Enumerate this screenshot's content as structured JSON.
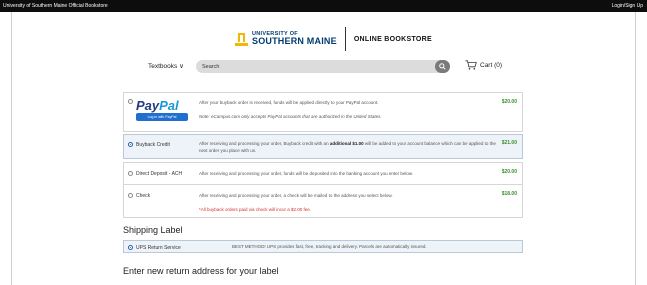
{
  "topbar": {
    "left": "University of Southern Maine Official Bookstore",
    "right": "Login/Sign Up"
  },
  "header": {
    "logo_line1": "UNIVERSITY OF",
    "logo_line2": "SOUTHERN MAINE",
    "store": "ONLINE BOOKSTORE"
  },
  "nav": {
    "textbooks": "Textbooks ∨",
    "search_placeholder": "Search",
    "cart": "Cart (0)"
  },
  "payment": {
    "paypal": {
      "logo_a": "Pay",
      "logo_b": "Pal",
      "button": "Log in with PayPal",
      "desc": "After your buyback order is received, funds will be applied directly to your PayPal account.",
      "note": "Note: eCampus.com only accepts PayPal accounts that are authorized in the United States.",
      "amount": "$20.00"
    },
    "buyback": {
      "label": "Buyback Credit",
      "desc_a": "After receiving and processing your order, Buyback credit with an ",
      "desc_b": "additional $1.00",
      "desc_c": " will be added to your account balance which can be applied to the next order you place with us.",
      "amount": "$21.00"
    },
    "ach": {
      "label": "Direct Deposit - ACH",
      "desc": "After receiving and processing your order, funds will be deposited into the banking account you enter below.",
      "amount": "$20.00"
    },
    "check": {
      "label": "Check",
      "desc": "After receiving and processing your order, a check will be mailed to the address you select below.",
      "warn": "*All buyback orders paid via check will incur a $2.00 fee.",
      "amount": "$18.00"
    }
  },
  "shipping": {
    "title": "Shipping Label",
    "ups_label": "UPS Return Service",
    "ups_desc": "BEST METHOD! UPS provides fast, free, tracking and delivery. Parcels are automatically insured."
  },
  "return_address": {
    "title": "Enter new return address for your label"
  },
  "colors": {
    "topbar": "#0d0d0d",
    "brand": "#003b71",
    "accent": "#f2b705",
    "amount": "#3b8f2f",
    "warning": "#d0342c",
    "selected_bg": "#edf3f8"
  }
}
